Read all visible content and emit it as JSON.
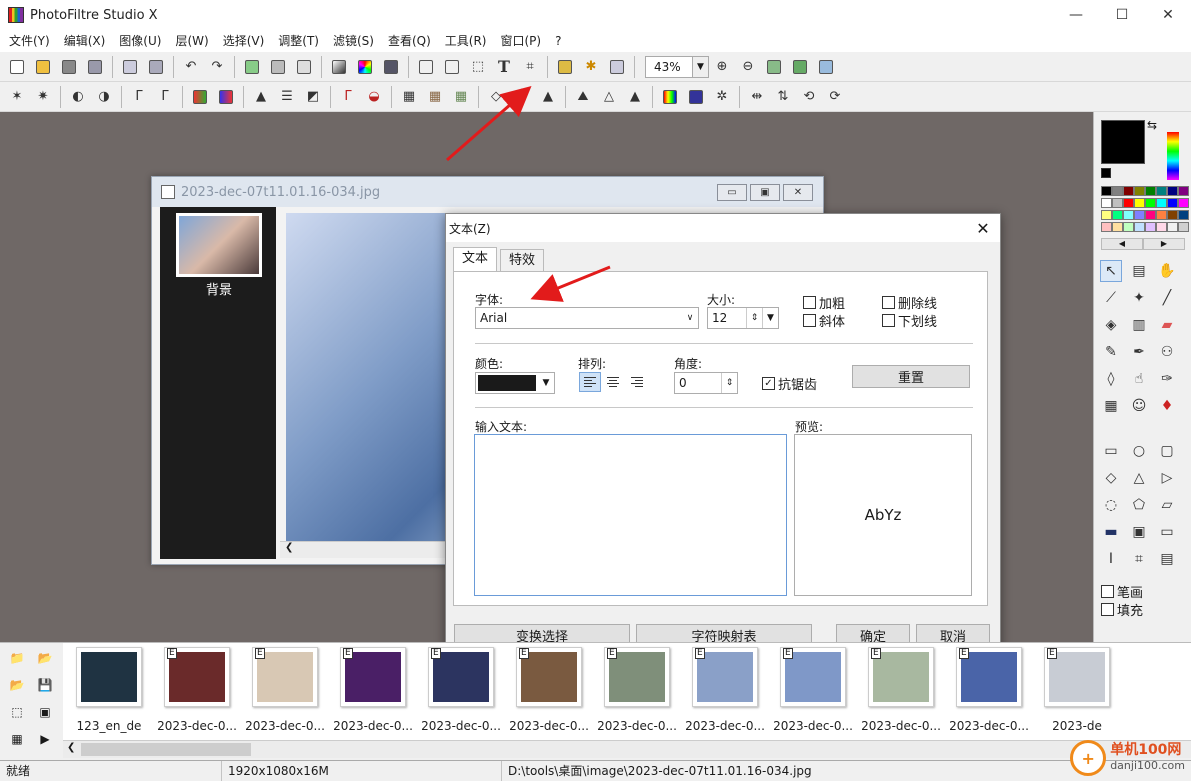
{
  "app": {
    "title": "PhotoFiltre Studio X"
  },
  "window_controls": {
    "minimize": "—",
    "maximize": "☐",
    "close": "✕"
  },
  "menu": [
    "文件(Y)",
    "编辑(X)",
    "图像(U)",
    "层(W)",
    "选择(V)",
    "调整(T)",
    "滤镜(S)",
    "查看(Q)",
    "工具(R)",
    "窗口(P)",
    "?"
  ],
  "toolbar": {
    "zoom": "43%"
  },
  "document": {
    "title": "2023-dec-07t11.01.16-034.jpg",
    "layer_label": "背景"
  },
  "text_dialog": {
    "title": "文本(Z)",
    "close": "✕",
    "tabs": [
      "文本",
      "特效"
    ],
    "font_label": "字体:",
    "font_value": "Arial",
    "size_label": "大小:",
    "size_value": "12",
    "bold": "加粗",
    "italic": "斜体",
    "strikethrough": "删除线",
    "underline": "下划线",
    "color_label": "颜色:",
    "color_value": "#1a1a1a",
    "align_label": "排列:",
    "angle_label": "角度:",
    "angle_value": "0",
    "antialias": "抗锯齿",
    "antialias_checked": true,
    "reset_button": "重置",
    "input_label": "输入文本:",
    "preview_label": "预览:",
    "preview_text": "AbYz",
    "buttons": {
      "transform": "变换选择",
      "charmap": "字符映射表",
      "ok": "确定",
      "cancel": "取消"
    }
  },
  "right_panel": {
    "outline": "笔画",
    "fill": "填充"
  },
  "thumbnails": [
    {
      "label": "123_en_de",
      "color": "#1f3342"
    },
    {
      "label": "2023-dec-0...",
      "color": "#6a2a2a"
    },
    {
      "label": "2023-dec-0...",
      "color": "#d8c8b4"
    },
    {
      "label": "2023-dec-0...",
      "color": "#4a1f66"
    },
    {
      "label": "2023-dec-0...",
      "color": "#2c3460"
    },
    {
      "label": "2023-dec-0...",
      "color": "#7a5a40"
    },
    {
      "label": "2023-dec-0...",
      "color": "#7f8f7a"
    },
    {
      "label": "2023-dec-0...",
      "color": "#8aa0c8"
    },
    {
      "label": "2023-dec-0...",
      "color": "#7f98c8"
    },
    {
      "label": "2023-dec-0...",
      "color": "#a8b8a0"
    },
    {
      "label": "2023-dec-0...",
      "color": "#4a64a8"
    },
    {
      "label": "2023-de",
      "color": "#c8ccd4"
    }
  ],
  "status": {
    "state": "就绪",
    "dims": "1920x1080x16M",
    "path": "D:\\tools\\桌面\\image\\2023-dec-07t11.01.16-034.jpg"
  },
  "watermark": {
    "brand": "单机100网",
    "url": "danji100.com"
  }
}
